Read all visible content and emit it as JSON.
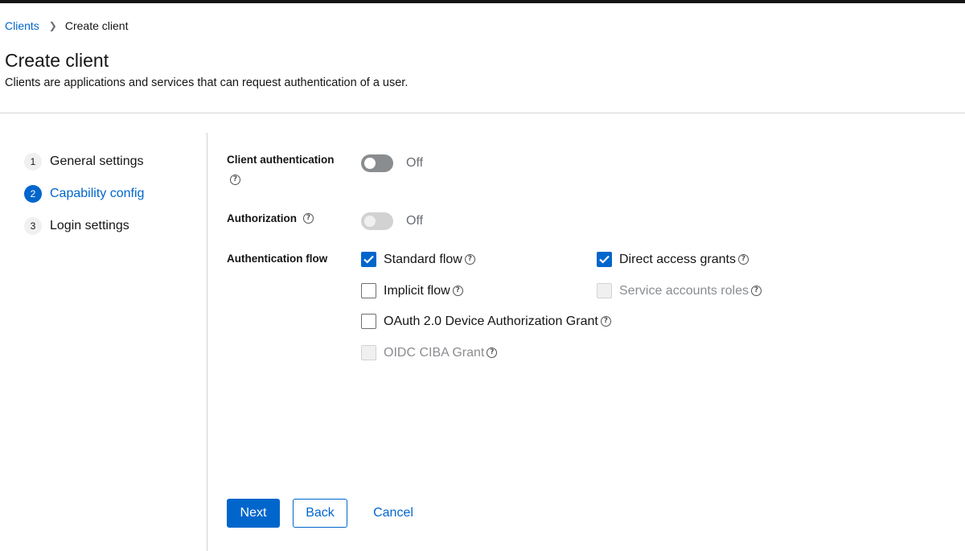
{
  "breadcrumb": {
    "parent": "Clients",
    "current": "Create client"
  },
  "header": {
    "title": "Create client",
    "description": "Clients are applications and services that can request authentication of a user."
  },
  "wizard": {
    "steps": [
      {
        "num": "1",
        "label": "General settings"
      },
      {
        "num": "2",
        "label": "Capability config",
        "current": true
      },
      {
        "num": "3",
        "label": "Login settings"
      }
    ]
  },
  "form": {
    "client_authentication": {
      "label": "Client authentication",
      "state": "Off"
    },
    "authorization": {
      "label": "Authorization",
      "state": "Off",
      "disabled": true
    },
    "authentication_flow": {
      "label": "Authentication flow",
      "options": [
        {
          "label": "Standard flow",
          "checked": true,
          "disabled": false
        },
        {
          "label": "Direct access grants",
          "checked": true,
          "disabled": false
        },
        {
          "label": "Implicit flow",
          "checked": false,
          "disabled": false
        },
        {
          "label": "Service accounts roles",
          "checked": false,
          "disabled": true
        },
        {
          "label": "OAuth 2.0 Device Authorization Grant",
          "checked": false,
          "disabled": false
        },
        {
          "label": "OIDC CIBA Grant",
          "checked": false,
          "disabled": true
        }
      ]
    }
  },
  "actions": {
    "next": "Next",
    "back": "Back",
    "cancel": "Cancel"
  },
  "icons": {
    "help": "help-circle-icon",
    "breadcrumb_separator": "chevron-right-icon",
    "check": "check-icon"
  },
  "colors": {
    "accent": "#0066cc",
    "toggle_off": "#8a8d90",
    "toggle_disabled": "#d2d2d2"
  }
}
